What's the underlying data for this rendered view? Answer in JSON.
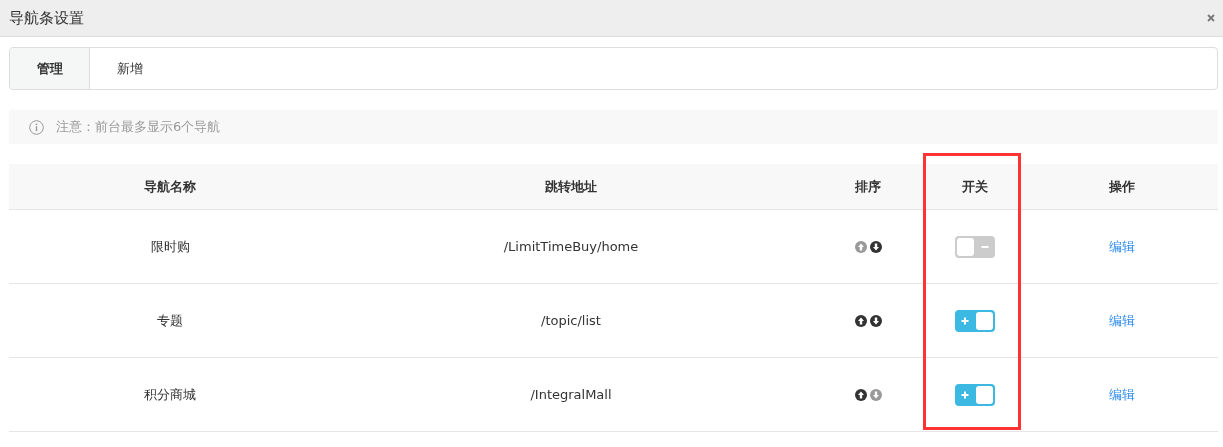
{
  "window": {
    "title": "导航条设置"
  },
  "tabs": [
    {
      "label": "管理",
      "selected": true
    },
    {
      "label": "新增",
      "selected": false
    }
  ],
  "notice": "注意：前台最多显示6个导航",
  "table": {
    "columns": [
      "导航名称",
      "跳转地址",
      "排序",
      "开关",
      "操作"
    ],
    "rows": [
      {
        "name": "限时购",
        "url": "/LimitTimeBuy/home",
        "up_disabled": true,
        "down_disabled": false,
        "on": false,
        "action": "编辑"
      },
      {
        "name": "专题",
        "url": "/topic/list",
        "up_disabled": false,
        "down_disabled": false,
        "on": true,
        "action": "编辑"
      },
      {
        "name": "积分商城",
        "url": "/IntegralMall",
        "up_disabled": false,
        "down_disabled": true,
        "on": true,
        "action": "编辑"
      }
    ]
  }
}
